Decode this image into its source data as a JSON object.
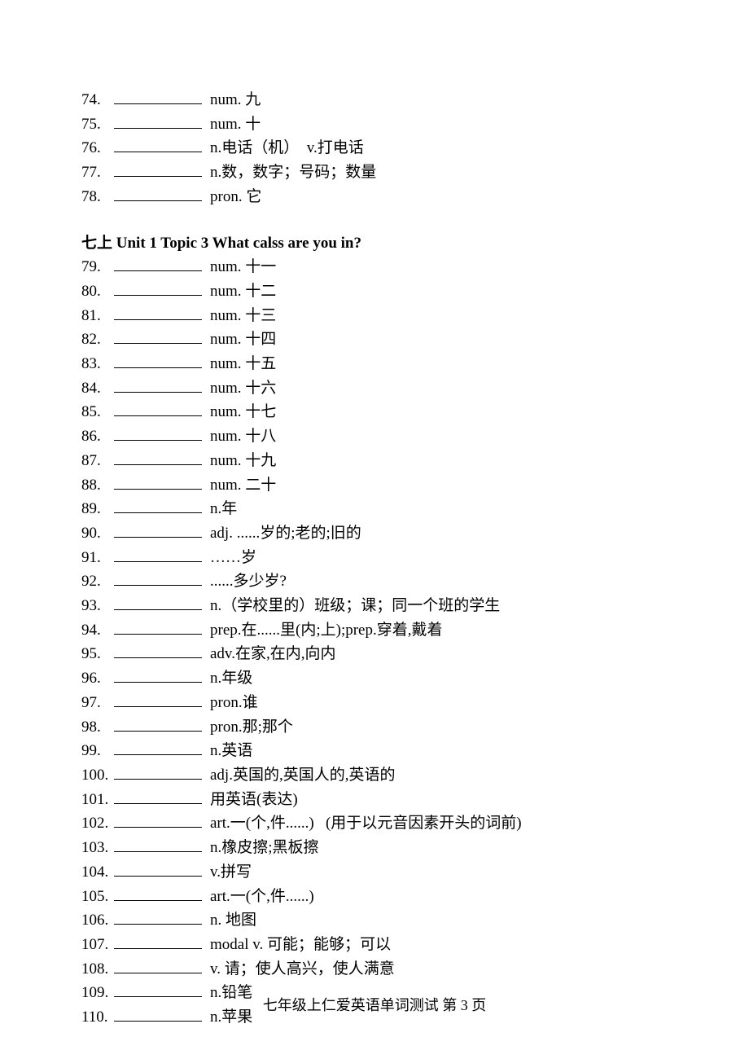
{
  "rows_top": [
    {
      "n": "74.",
      "def": "num. 九"
    },
    {
      "n": "75.",
      "def": "num. 十"
    },
    {
      "n": "76.",
      "def": "n.电话（机）  v.打电话"
    },
    {
      "n": "77.",
      "def": "n.数，数字；号码；数量"
    },
    {
      "n": "78.",
      "def": "pron. 它"
    }
  ],
  "heading": "七上 Unit 1    Topic 3    What calss are you in?",
  "rows_bottom": [
    {
      "n": "79.",
      "def": "num. 十一"
    },
    {
      "n": "80.",
      "def": "num. 十二"
    },
    {
      "n": "81.",
      "def": "num. 十三"
    },
    {
      "n": "82.",
      "def": "num. 十四"
    },
    {
      "n": "83.",
      "def": "num. 十五"
    },
    {
      "n": "84.",
      "def": "num. 十六"
    },
    {
      "n": "85.",
      "def": "num. 十七"
    },
    {
      "n": "86.",
      "def": "num. 十八"
    },
    {
      "n": "87.",
      "def": "num. 十九"
    },
    {
      "n": "88.",
      "def": "num. 二十"
    },
    {
      "n": "89.",
      "def": "n.年"
    },
    {
      "n": "90.",
      "def": "adj. ......岁的;老的;旧的"
    },
    {
      "n": "91.",
      "def": "……岁"
    },
    {
      "n": "92.",
      "def": "......多少岁?"
    },
    {
      "n": "93.",
      "def": "n.（学校里的）班级；课；同一个班的学生"
    },
    {
      "n": "94.",
      "def": "prep.在......里(内;上);prep.穿着,戴着"
    },
    {
      "n": "95.",
      "def": "adv.在家,在内,向内"
    },
    {
      "n": "96.",
      "def": "n.年级"
    },
    {
      "n": "97.",
      "def": "pron.谁"
    },
    {
      "n": "98.",
      "def": "pron.那;那个"
    },
    {
      "n": "99.",
      "def": "n.英语"
    },
    {
      "n": "100.",
      "def": "adj.英国的,英国人的,英语的"
    },
    {
      "n": "101.",
      "def": "用英语(表达)"
    },
    {
      "n": "102.",
      "def": "art.一(个,件......)   (用于以元音因素开头的词前)"
    },
    {
      "n": "103.",
      "def": "n.橡皮擦;黑板擦"
    },
    {
      "n": "104.",
      "def": "v.拼写"
    },
    {
      "n": "105.",
      "def": "art.一(个,件......)"
    },
    {
      "n": "106.",
      "def": "n. 地图"
    },
    {
      "n": "107.",
      "def": "modal v. 可能；能够；可以"
    },
    {
      "n": "108.",
      "def": "v. 请；使人高兴，使人满意"
    },
    {
      "n": "109.",
      "def": "n.铅笔"
    },
    {
      "n": "110.",
      "def": "n.苹果"
    }
  ],
  "footer": "七年级上仁爱英语单词测试     第 3 页"
}
